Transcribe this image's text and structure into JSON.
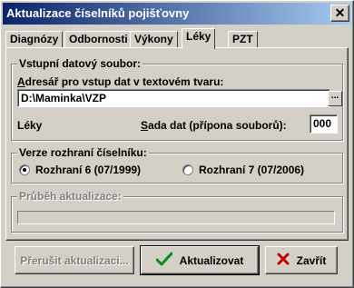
{
  "window": {
    "title": "Aktualizace číselníků pojišťovny",
    "close_symbol": "✕"
  },
  "tabs": [
    "Diagnózy",
    "Odbornosti",
    "Výkony",
    "Léky",
    "PZT"
  ],
  "active_tab": "Léky",
  "input_group": {
    "title": "Vstupní datový soubor:",
    "path_label_hotkey": "A",
    "path_label_rest": "dresář pro vstup dat v textovém tvaru:",
    "path_value": "D:\\Maminka\\VZP",
    "browse_label": "...",
    "type_label": "Léky",
    "dataset_label_hotkey": "S",
    "dataset_label_rest": "ada dat (přípona souborů):",
    "dataset_value": "000"
  },
  "interface_group": {
    "title": "Verze rozhraní číselníku:",
    "options": [
      {
        "label": "Rozhraní 6 (07/1999)",
        "checked": true
      },
      {
        "label": "Rozhraní 7 (07/2006)",
        "checked": false
      }
    ]
  },
  "progress_group": {
    "title": "Průběh aktualizace:",
    "progress": 0
  },
  "buttons": {
    "interrupt": "Přerušit aktualizaci...",
    "update": "Aktualizovat",
    "close": "Zavřít"
  },
  "colors": {
    "titlebar_start": "#0a246a",
    "titlebar_end": "#a6caf0",
    "face": "#d4d0c8",
    "check_green": "#0a8a1e",
    "cross_red": "#c00000"
  }
}
